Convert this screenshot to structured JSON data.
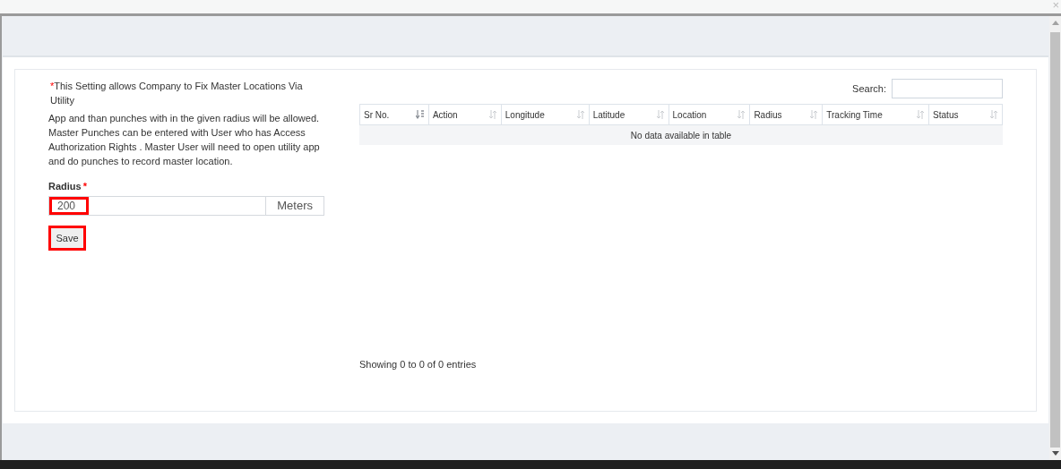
{
  "close_glyph": "×",
  "note": {
    "mark": "*",
    "first_line": "This Setting allows Company to Fix Master Locations Via Utility",
    "body": "App and than punches with in the given radius will be allowed. Master Punches can be entered with User who has Access Authorization Rights . Master User will need to open utility app and do punches to record master location."
  },
  "radius": {
    "label": "Radius",
    "required_mark": "*",
    "value": "200",
    "unit": "Meters",
    "highlighted": true
  },
  "save_button": {
    "label": "Save",
    "highlighted": true
  },
  "search": {
    "label": "Search:"
  },
  "table": {
    "columns": [
      {
        "label": "Sr No.",
        "sorted": true
      },
      {
        "label": "Action",
        "sorted": false
      },
      {
        "label": "Longitude",
        "sorted": false
      },
      {
        "label": "Latitude",
        "sorted": false
      },
      {
        "label": "Location",
        "sorted": false
      },
      {
        "label": "Radius",
        "sorted": false
      },
      {
        "label": "Tracking Time",
        "sorted": false
      },
      {
        "label": "Status",
        "sorted": false
      }
    ],
    "empty_message": "No data available in table"
  },
  "info": "Showing 0 to 0 of 0 entries"
}
